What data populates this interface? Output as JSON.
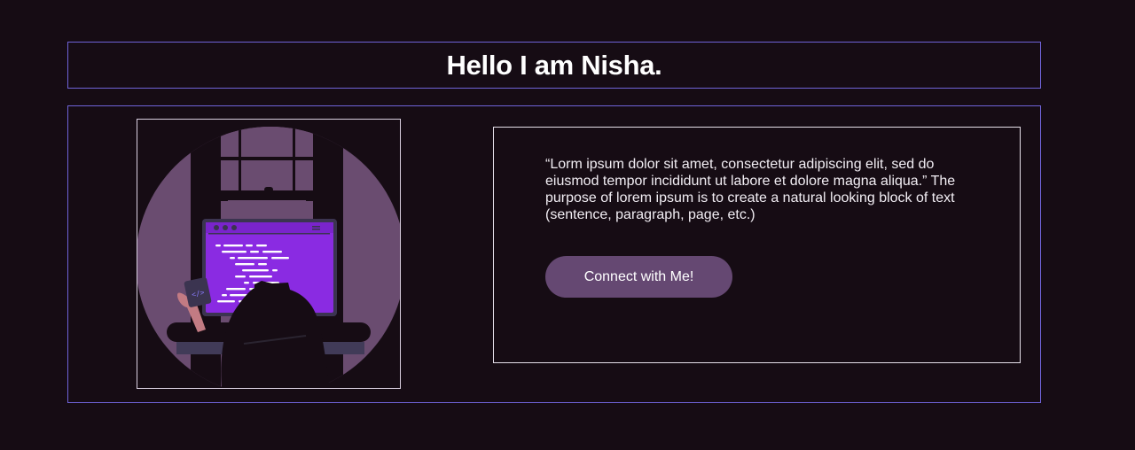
{
  "header": {
    "title": "Hello I am Nisha."
  },
  "about": {
    "quote": "“Lorm ipsum dolor sit amet, consectetur adipiscing elit, sed do eiusmod tempor incididunt ut labore et dolore magna aliqua.” The purpose of lorem ipsum is to create a natural looking block of text (sentence, paragraph, page, etc.)",
    "cta_label": "Connect with Me!"
  },
  "illustration": {
    "name": "programmer-at-desk-illustration"
  },
  "colors": {
    "background": "#160c14",
    "border_accent": "#6f63d8",
    "button": "#654872",
    "screen": "#8a2be2",
    "circle": "#6a4c70"
  }
}
